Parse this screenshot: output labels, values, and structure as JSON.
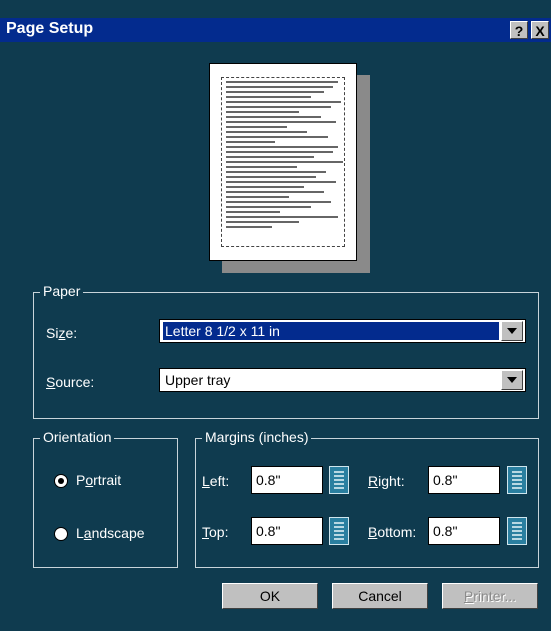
{
  "dialog": {
    "title": "Page Setup",
    "help_glyph": "?",
    "close_glyph": "X"
  },
  "preview": {
    "lines": 30
  },
  "paper": {
    "group_label": "Paper",
    "size_label_pre": "Si",
    "size_label_u": "z",
    "size_label_post": "e:",
    "size_value": "Letter 8 1/2 x 11 in",
    "source_label_u": "S",
    "source_label_post": "ource:",
    "source_value": "Upper tray"
  },
  "orientation": {
    "group_label": "Orientation",
    "portrait_pre": "P",
    "portrait_u": "o",
    "portrait_post": "rtrait",
    "landscape_pre": "L",
    "landscape_u": "a",
    "landscape_post": "ndscape",
    "selected": "portrait"
  },
  "margins": {
    "group_label": "Margins (inches)",
    "left_u": "L",
    "left_post": "eft:",
    "left_value": "0.8\"",
    "right_u": "R",
    "right_post": "ight:",
    "right_value": "0.8\"",
    "top_u": "T",
    "top_post": "op:",
    "top_value": "0.8\"",
    "bottom_u": "B",
    "bottom_post": "ottom:",
    "bottom_value": "0.8\""
  },
  "buttons": {
    "ok": "OK",
    "cancel": "Cancel",
    "printer_u": "P",
    "printer_post": "rinter..."
  },
  "colors": {
    "titlebar": "#032b8e",
    "body": "#0f3b4f",
    "selection": "#032b8e"
  }
}
